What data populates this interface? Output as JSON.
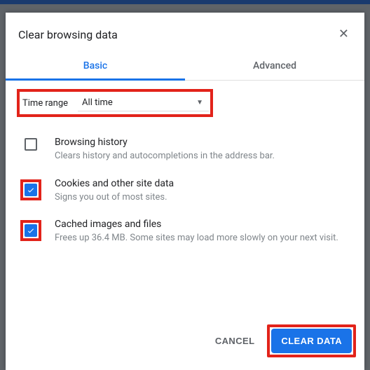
{
  "dialog": {
    "title": "Clear browsing data",
    "close": "✕"
  },
  "tabs": {
    "basic": "Basic",
    "advanced": "Advanced"
  },
  "time": {
    "label": "Time range",
    "selected": "All time"
  },
  "options": [
    {
      "title": "Browsing history",
      "desc": "Clears history and autocompletions in the address bar.",
      "checked": false,
      "highlighted": false
    },
    {
      "title": "Cookies and other site data",
      "desc": "Signs you out of most sites.",
      "checked": true,
      "highlighted": true
    },
    {
      "title": "Cached images and files",
      "desc": "Frees up 36.4 MB. Some sites may load more slowly on your next visit.",
      "checked": true,
      "highlighted": true
    }
  ],
  "footer": {
    "cancel": "CANCEL",
    "clear": "CLEAR DATA"
  }
}
